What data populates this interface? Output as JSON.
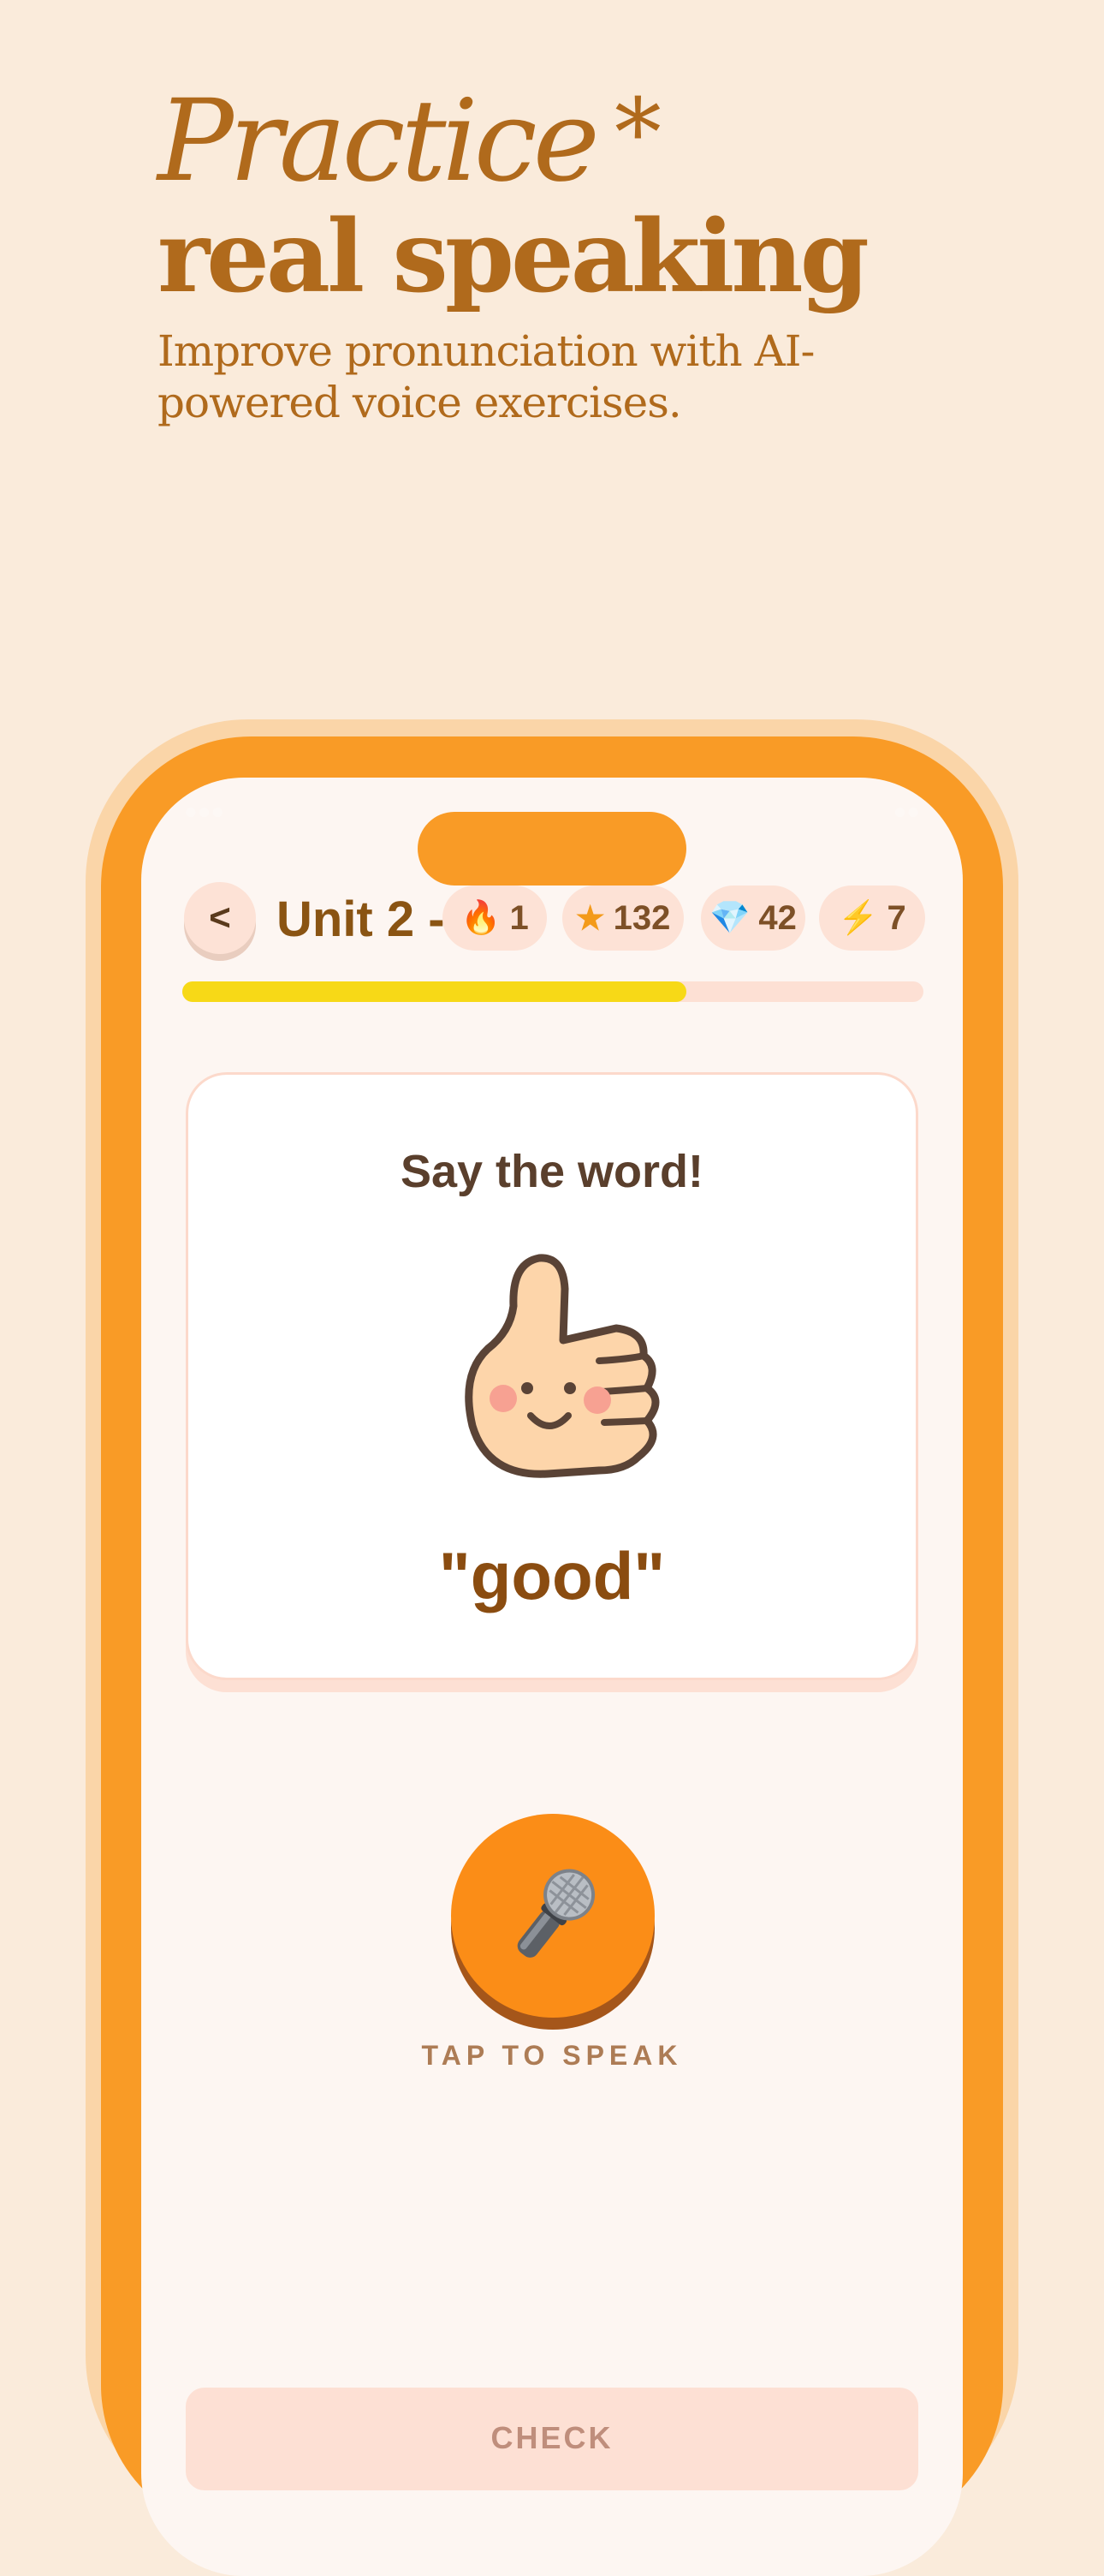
{
  "hero": {
    "line1": "Practice",
    "line1_mark": "*",
    "line2": "real speaking",
    "subtitle": "Improve pronunciation with AI-powered voice exercises."
  },
  "lesson_header": {
    "back_label": "<",
    "unit_title": "Unit 2 -",
    "stats": {
      "streak": "1",
      "stars": "132",
      "gems": "42",
      "energy": "7"
    },
    "progress_fraction": 0.68
  },
  "exercise": {
    "prompt": "Say the word!",
    "word": "\"good\""
  },
  "mic": {
    "label": "TAP TO SPEAK"
  },
  "check_button": {
    "label": "CHECK"
  },
  "icons": {
    "streak": "flame-icon",
    "stars": "star-icon",
    "gems": "gem-icon",
    "energy": "lightning-icon",
    "mic": "microphone-icon",
    "illustration": "thumbs-up-icon"
  },
  "colors": {
    "background": "#faebdb",
    "brand_orange": "#f99b26",
    "hero_text": "#b06a1c",
    "progress_fill": "#f7d917",
    "pill_bg": "#fde2d6"
  }
}
